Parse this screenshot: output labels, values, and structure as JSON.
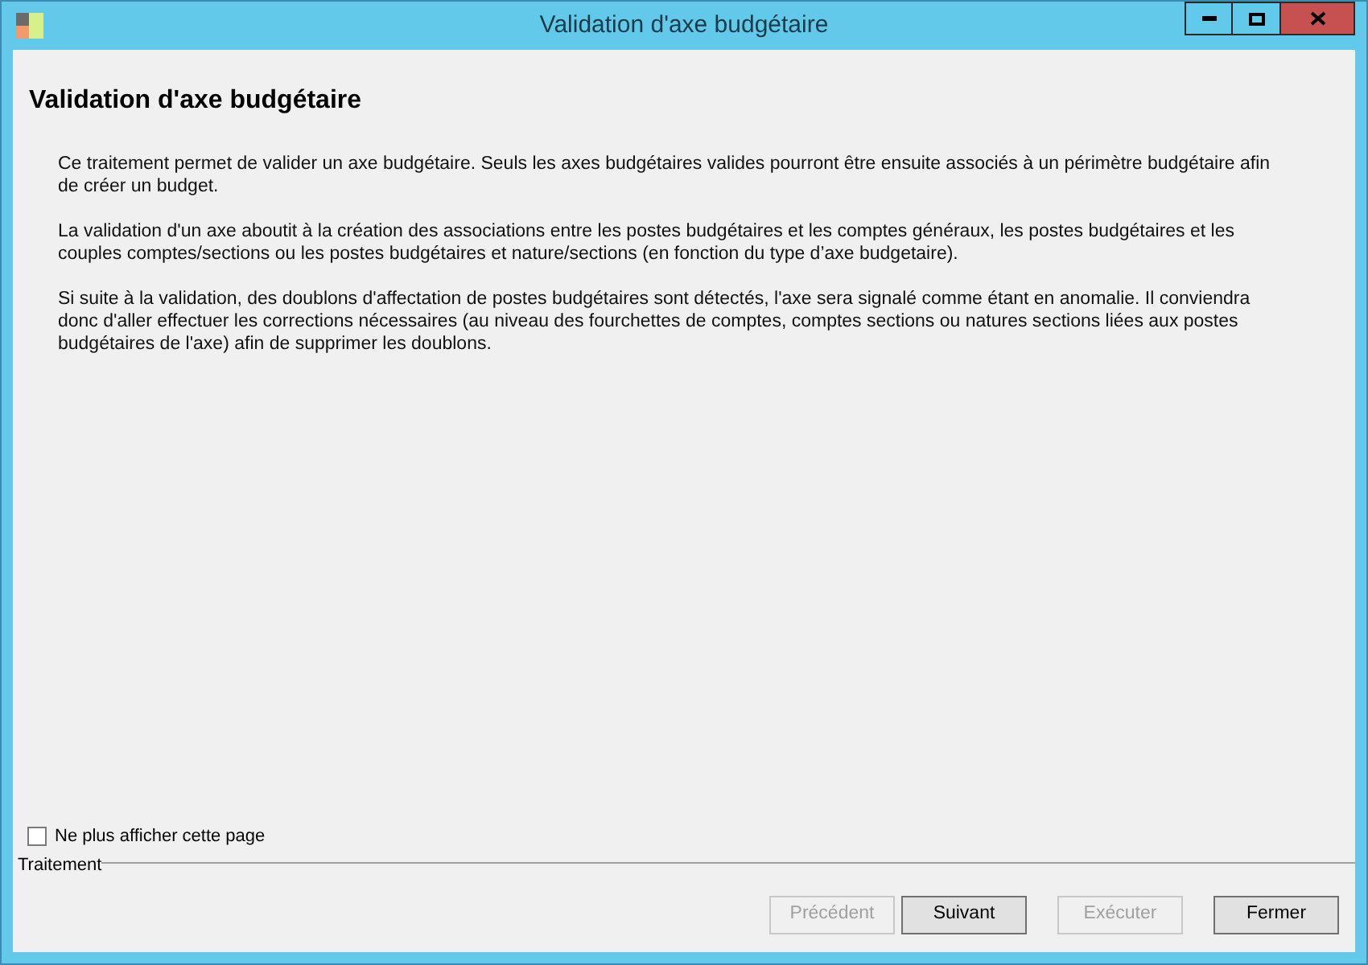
{
  "window": {
    "title": "Validation d'axe budgétaire"
  },
  "heading": "Validation d'axe budgétaire",
  "paragraphs": [
    "Ce traitement permet de valider un axe budgétaire. Seuls les axes budgétaires valides pourront être ensuite associés à un périmètre budgétaire afin de créer un budget.",
    "La validation d'un axe aboutit à la création des associations entre les postes budgétaires et les comptes généraux, les postes budgétaires et les couples comptes/sections ou les postes budgétaires et nature/sections (en fonction du type d’axe budgetaire).",
    "Si suite à la validation, des doublons d'affectation de postes budgétaires sont détectés, l'axe sera signalé comme étant en anomalie. Il conviendra donc d'aller effectuer les corrections nécessaires (au niveau des fourchettes de comptes, comptes sections ou natures sections liées aux postes budgétaires de l'axe) afin de supprimer les doublons."
  ],
  "checkbox": {
    "label": "Ne plus afficher cette page",
    "checked": false
  },
  "group_label": "Traitement",
  "buttons": [
    {
      "label": "Précédent",
      "disabled": true
    },
    {
      "label": "Suivant",
      "disabled": false
    },
    {
      "label": "Exécuter",
      "disabled": true
    },
    {
      "label": "Fermer",
      "disabled": false
    }
  ]
}
